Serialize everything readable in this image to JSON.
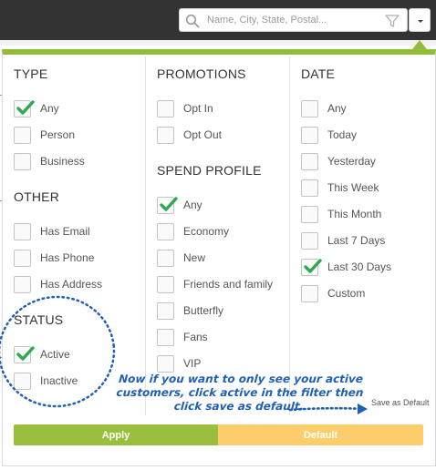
{
  "search": {
    "placeholder": "Name, City, State, Postal..."
  },
  "columns": [
    {
      "sections": [
        {
          "title": "TYPE",
          "options": [
            {
              "label": "Any",
              "checked": true
            },
            {
              "label": "Person",
              "checked": false
            },
            {
              "label": "Business",
              "checked": false
            }
          ]
        },
        {
          "title": "OTHER",
          "options": [
            {
              "label": "Has Email",
              "checked": false
            },
            {
              "label": "Has Phone",
              "checked": false
            },
            {
              "label": "Has Address",
              "checked": false
            }
          ]
        },
        {
          "title": "STATUS",
          "options": [
            {
              "label": "Active",
              "checked": true
            },
            {
              "label": "Inactive",
              "checked": false
            }
          ]
        }
      ]
    },
    {
      "sections": [
        {
          "title": "PROMOTIONS",
          "options": [
            {
              "label": "Opt In",
              "checked": false
            },
            {
              "label": "Opt Out",
              "checked": false
            }
          ]
        },
        {
          "title": "SPEND PROFILE",
          "options": [
            {
              "label": "Any",
              "checked": true
            },
            {
              "label": "Economy",
              "checked": false
            },
            {
              "label": "New",
              "checked": false
            },
            {
              "label": "Friends and family",
              "checked": false
            },
            {
              "label": "Butterfly",
              "checked": false
            },
            {
              "label": "Fans",
              "checked": false
            },
            {
              "label": "VIP",
              "checked": false
            }
          ]
        }
      ]
    },
    {
      "sections": [
        {
          "title": "DATE",
          "options": [
            {
              "label": "Any",
              "checked": false
            },
            {
              "label": "Today",
              "checked": false
            },
            {
              "label": "Yesterday",
              "checked": false
            },
            {
              "label": "This Week",
              "checked": false
            },
            {
              "label": "This Month",
              "checked": false
            },
            {
              "label": "Last 7 Days",
              "checked": false
            },
            {
              "label": "Last 30 Days",
              "checked": true
            },
            {
              "label": "Custom",
              "checked": false
            }
          ]
        }
      ]
    }
  ],
  "annotation": {
    "line1": "Now if you want to only see your active",
    "line2": "customers, click active in the filter then",
    "line3": "click save as default."
  },
  "save_as_default_label": "Save as Default",
  "buttons": {
    "apply": "Apply",
    "default": "Default"
  },
  "colors": {
    "accent_green": "#95bb3c",
    "apply_green": "#9abe3e",
    "default_yellow": "#fdcc6b",
    "check_green": "#2fa84f",
    "annotation_blue": "#1f5fb5"
  }
}
